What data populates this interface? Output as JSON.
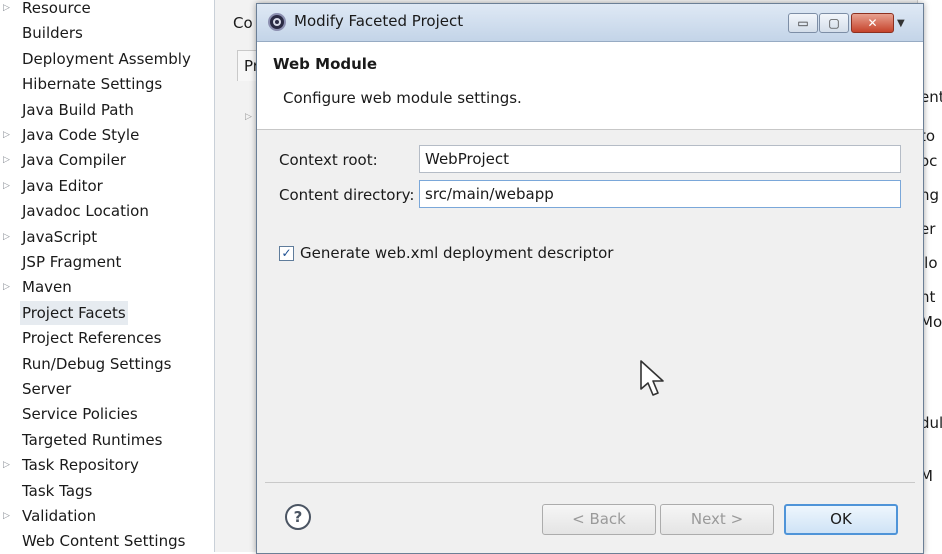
{
  "sidebar": {
    "items": [
      {
        "label": "Resource",
        "expandable": true
      },
      {
        "label": "Builders",
        "expandable": false
      },
      {
        "label": "Deployment Assembly",
        "expandable": false
      },
      {
        "label": "Hibernate Settings",
        "expandable": false
      },
      {
        "label": "Java Build Path",
        "expandable": false
      },
      {
        "label": "Java Code Style",
        "expandable": true
      },
      {
        "label": "Java Compiler",
        "expandable": true
      },
      {
        "label": "Java Editor",
        "expandable": true
      },
      {
        "label": "Javadoc Location",
        "expandable": false
      },
      {
        "label": "JavaScript",
        "expandable": true
      },
      {
        "label": "JSP Fragment",
        "expandable": false
      },
      {
        "label": "Maven",
        "expandable": true
      },
      {
        "label": "Project Facets",
        "expandable": false,
        "selected": true
      },
      {
        "label": "Project References",
        "expandable": false
      },
      {
        "label": "Run/Debug Settings",
        "expandable": false
      },
      {
        "label": "Server",
        "expandable": false
      },
      {
        "label": "Service Policies",
        "expandable": false
      },
      {
        "label": "Targeted Runtimes",
        "expandable": false
      },
      {
        "label": "Task Repository",
        "expandable": true
      },
      {
        "label": "Task Tags",
        "expandable": false
      },
      {
        "label": "Validation",
        "expandable": true
      },
      {
        "label": "Web Content Settings",
        "expandable": false
      }
    ]
  },
  "background": {
    "heading": "Co",
    "tab": "Pr",
    "right_fragments": [
      "ent",
      "to",
      "oc",
      "ng",
      "er",
      "llo",
      "nt",
      "Mo",
      "dul",
      "M"
    ]
  },
  "dialog": {
    "title": "Modify Faceted Project",
    "banner_title": "Web Module",
    "banner_desc": "Configure web module settings.",
    "context_root_label": "Context root:",
    "context_root_value": "WebProject",
    "content_dir_label": "Content directory:",
    "content_dir_value": "src/main/webapp",
    "checkbox_label": "Generate web.xml deployment descriptor",
    "checkbox_checked": true,
    "help_label": "?",
    "back_label": "< Back",
    "next_label": "Next >",
    "ok_label": "OK",
    "min_symbol": "▭",
    "max_symbol": "▢",
    "close_symbol": "✕",
    "menu_symbol": "▼",
    "check_symbol": "✓"
  },
  "colors": {
    "accent": "#4f94d8",
    "selection": "#e6ebf0",
    "close_red": "#c5432b"
  }
}
